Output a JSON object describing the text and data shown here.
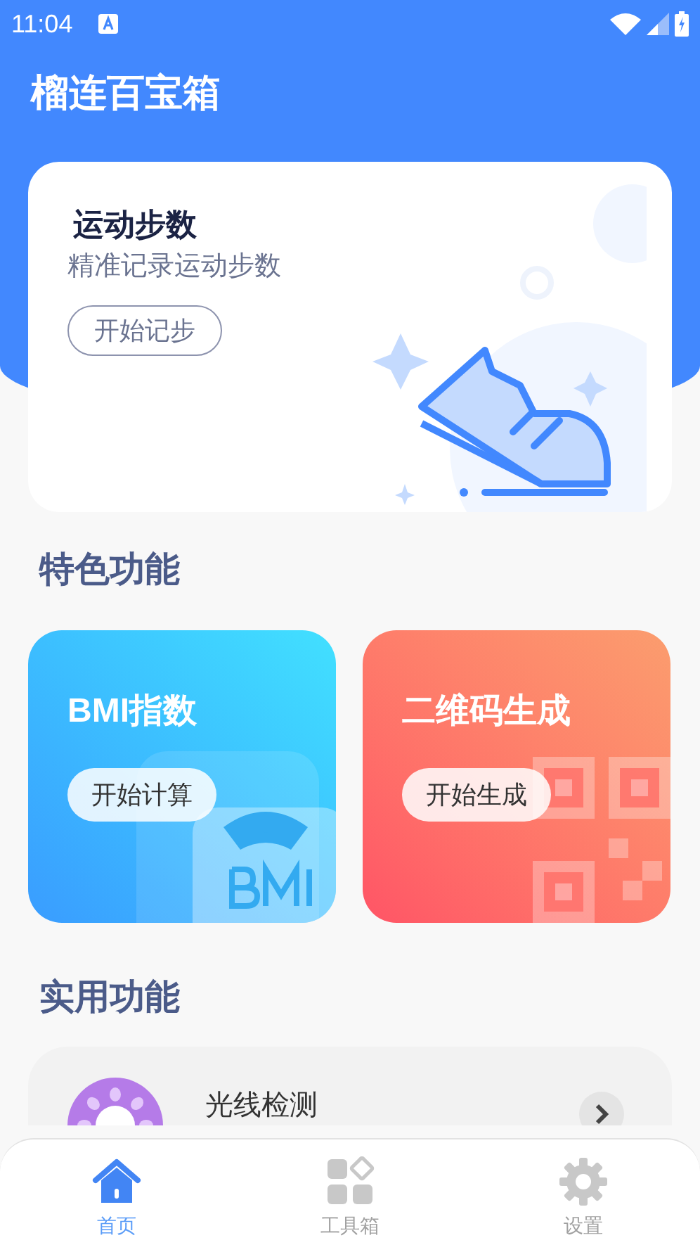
{
  "status_bar": {
    "time": "11:04"
  },
  "app_title": "榴连百宝箱",
  "step_card": {
    "title": "运动步数",
    "subtitle": "精准记录运动步数",
    "button": "开始记步"
  },
  "featured": {
    "heading": "特色功能",
    "cards": [
      {
        "kind": "bmi",
        "title": "BMI指数",
        "button": "开始计算"
      },
      {
        "kind": "qr",
        "title": "二维码生成",
        "button": "开始生成"
      }
    ]
  },
  "utilities": {
    "heading": "实用功能",
    "items": [
      {
        "label": "光线检测"
      }
    ]
  },
  "bottom_nav": [
    {
      "kind": "home",
      "label": "首页",
      "selected": true
    },
    {
      "kind": "tools",
      "label": "工具箱",
      "selected": false
    },
    {
      "kind": "settings",
      "label": "设置",
      "selected": false
    }
  ]
}
